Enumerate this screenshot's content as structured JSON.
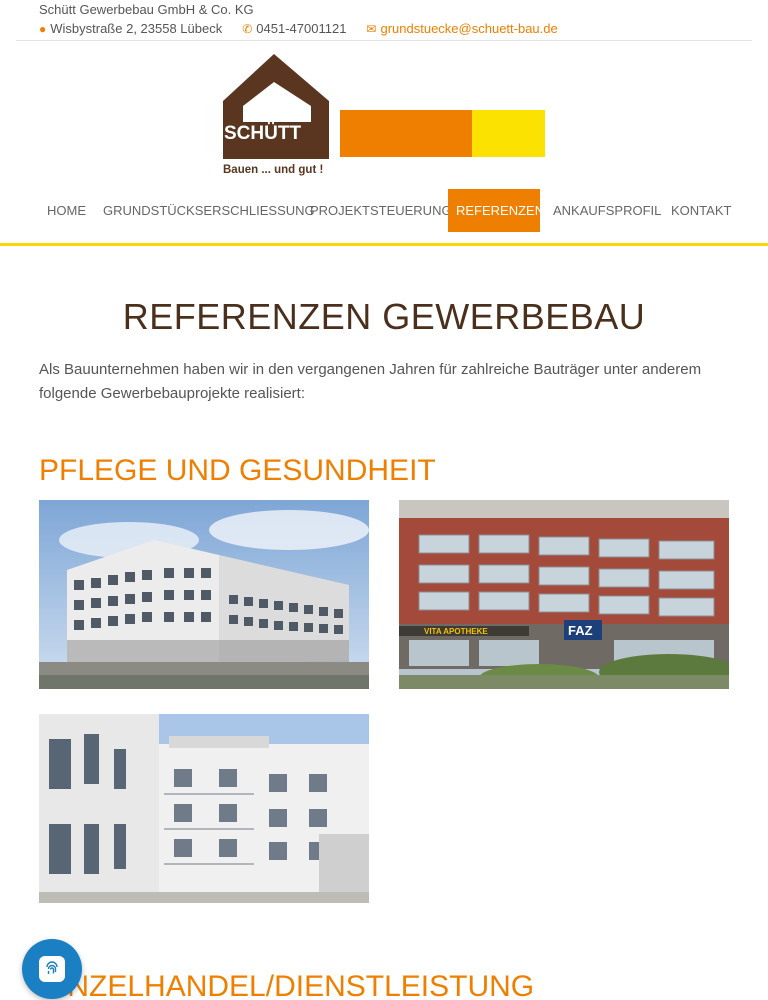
{
  "topbar": {
    "company": "Schütt Gewerbebau GmbH & Co. KG",
    "address": "Wisbystraße 2, 23558 Lübeck",
    "phone": "0451-47001121",
    "email": "grundstuecke@schuett-bau.de",
    "icons": {
      "address": "map-marker-icon",
      "phone": "phone-icon",
      "email": "envelope-icon"
    },
    "accent": "#ee7f00"
  },
  "logo": {
    "wordmark": "SCHÜTT",
    "slogan": "Bauen ... und gut !",
    "colors": {
      "brown": "#5a3620",
      "orange": "#ee7f00",
      "yellow": "#fbe200"
    }
  },
  "nav": {
    "items": [
      {
        "label": "HOME",
        "active": false
      },
      {
        "label": "GRUNDSTÜCKSERSCHLIESSUNG",
        "active": false
      },
      {
        "label": "PROJEKTSTEUERUNG",
        "active": false
      },
      {
        "label": "REFERENZEN",
        "active": true
      },
      {
        "label": "ANKAUFSPROFIL",
        "active": false
      },
      {
        "label": "KONTAKT",
        "active": false
      }
    ],
    "active_color": "#ee7f00",
    "underline_color": "#fbd600"
  },
  "main": {
    "title": "REFERENZEN GEWERBEBAU",
    "intro": "Als Bauunternehmen haben wir in den vergangenen Jahren für zahlreiche Bauträger unter anderem folgende Gewerbebauprojekte realisiert:",
    "sections": [
      {
        "title": "PFLEGE UND GESUNDHEIT"
      },
      {
        "title": "EINZELHANDEL/DIENSTLEISTUNG"
      }
    ],
    "photo_signs": {
      "pharmacy": "VITA APOTHEKE",
      "faz": "FAZ"
    }
  },
  "chat": {
    "icon": "fingerprint-icon"
  }
}
